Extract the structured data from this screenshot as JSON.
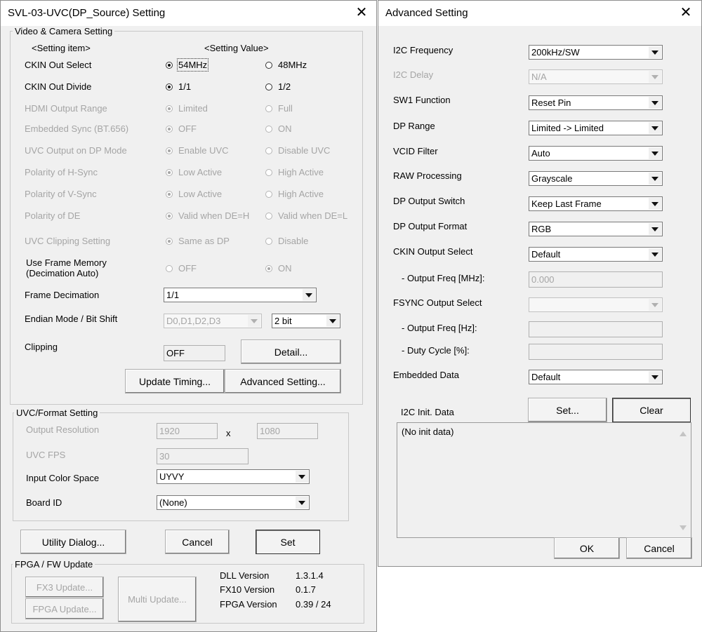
{
  "left": {
    "title": "SVL-03-UVC(DP_Source) Setting",
    "close_glyph": "✕",
    "video": {
      "group_label": "Video & Camera Setting",
      "header_item": "<Setting item>",
      "header_value": "<Setting Value>",
      "rows": [
        {
          "label": "CKIN Out Select",
          "opt1": "54MHz",
          "opt2": "48MHz"
        },
        {
          "label": "CKIN Out Divide",
          "opt1": "1/1",
          "opt2": "1/2"
        },
        {
          "label": "HDMI Output Range",
          "opt1": "Limited",
          "opt2": "Full"
        },
        {
          "label": "Embedded Sync (BT.656)",
          "opt1": "OFF",
          "opt2": "ON"
        },
        {
          "label": "UVC Output on DP Mode",
          "opt1": "Enable UVC",
          "opt2": "Disable UVC"
        },
        {
          "label": "Polarity of H-Sync",
          "opt1": "Low Active",
          "opt2": "High Active"
        },
        {
          "label": "Polarity of V-Sync",
          "opt1": "Low Active",
          "opt2": "High Active"
        },
        {
          "label": "Polarity of DE",
          "opt1": "Valid when DE=H",
          "opt2": "Valid when DE=L"
        },
        {
          "label": "UVC Clipping Setting",
          "opt1": "Same as DP",
          "opt2": "Disable"
        }
      ],
      "frame_memory_line1": "Use Frame Memory",
      "frame_memory_line2": "(Decimation Auto)",
      "frame_memory_opt1": "OFF",
      "frame_memory_opt2": "ON",
      "frame_decimation_label": "Frame Decimation",
      "frame_decimation_value": "1/1",
      "endian_label": "Endian Mode / Bit Shift",
      "endian_value": "D0,D1,D2,D3",
      "bitshift_value": "2 bit",
      "clipping_label": "Clipping",
      "clipping_value": "OFF",
      "detail_button": "Detail...",
      "update_timing_button": "Update Timing...",
      "advanced_button": "Advanced Setting..."
    },
    "uvc": {
      "group_label": "UVC/Format Setting",
      "resolution_label": "Output Resolution",
      "res_width": "1920",
      "res_x": "x",
      "res_height": "1080",
      "fps_label": "UVC FPS",
      "fps_value": "30",
      "color_label": "Input Color Space",
      "color_value": "UYVY",
      "board_label": "Board ID",
      "board_value": "(None)"
    },
    "buttons": {
      "utility": "Utility Dialog...",
      "cancel": "Cancel",
      "set": "Set"
    },
    "fpga": {
      "group_label": "FPGA / FW Update",
      "fx3_button": "FX3 Update...",
      "fpga_button": "FPGA Update...",
      "multi_button": "Multi Update...",
      "dll_label": "DLL Version",
      "dll_value": "1.3.1.4",
      "fx10_label": "FX10 Version",
      "fx10_value": "0.1.7",
      "fpgav_label": "FPGA Version",
      "fpgav_value": "0.39 / 24"
    }
  },
  "right": {
    "title": "Advanced Setting",
    "close_glyph": "✕",
    "fields": {
      "i2c_freq_label": "I2C Frequency",
      "i2c_freq_value": "200kHz/SW",
      "i2c_delay_label": "I2C Delay",
      "i2c_delay_value": "N/A",
      "sw1_label": "SW1 Function",
      "sw1_value": "Reset Pin",
      "dp_range_label": "DP Range",
      "dp_range_value": "Limited -> Limited",
      "vcid_label": "VCID Filter",
      "vcid_value": "Auto",
      "raw_label": "RAW Processing",
      "raw_value": "Grayscale",
      "dp_switch_label": "DP Output Switch",
      "dp_switch_value": "Keep Last Frame",
      "dp_format_label": "DP Output Format",
      "dp_format_value": "RGB",
      "ckin_label": "CKIN Output Select",
      "ckin_value": "Default",
      "out_freq_mhz_label": "- Output Freq [MHz]:",
      "out_freq_mhz_value": "0.000",
      "fsync_label": "FSYNC Output Select",
      "fsync_value": "",
      "out_freq_hz_label": "- Output Freq [Hz]:",
      "out_freq_hz_value": "",
      "duty_label": "- Duty Cycle [%]:",
      "duty_value": "",
      "embedded_label": "Embedded Data",
      "embedded_value": "Default"
    },
    "i2c_init_label": "I2C Init. Data",
    "set_button": "Set...",
    "clear_button": "Clear",
    "init_data_text": "(No init data)",
    "ok_button": "OK",
    "cancel_button": "Cancel"
  }
}
